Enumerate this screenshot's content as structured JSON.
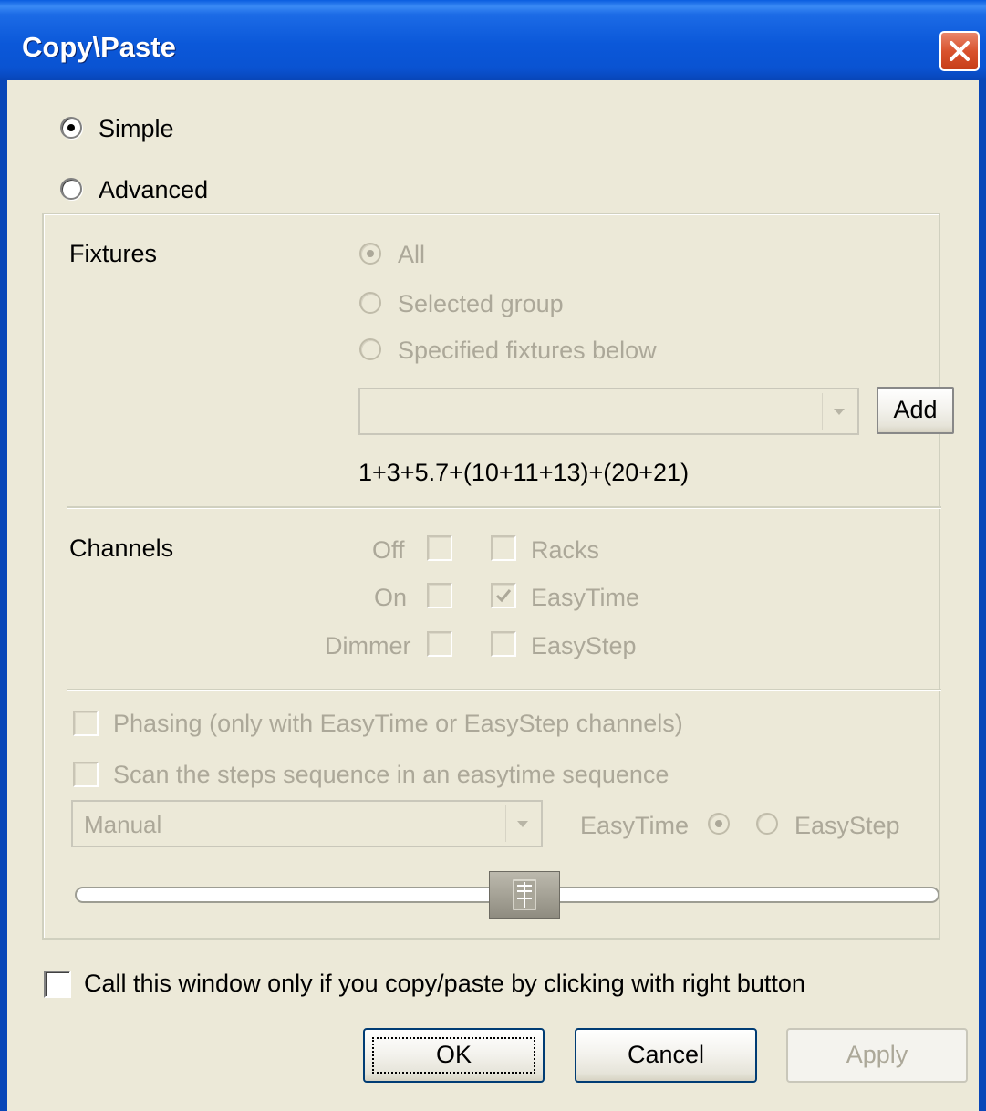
{
  "window": {
    "title": "Copy\\Paste"
  },
  "mode": {
    "simple": {
      "label": "Simple",
      "checked": true
    },
    "advanced": {
      "label": "Advanced",
      "checked": false
    }
  },
  "fixtures": {
    "heading": "Fixtures",
    "all": "All",
    "selected_group": "Selected group",
    "specified": "Specified fixtures below",
    "combo_value": "",
    "add_label": "Add",
    "expression": "1+3+5.7+(10+11+13)+(20+21)"
  },
  "channels": {
    "heading": "Channels",
    "off": "Off",
    "on": "On",
    "dimmer": "Dimmer",
    "racks": "Racks",
    "easytime": "EasyTime",
    "easystep": "EasyStep"
  },
  "options": {
    "phasing": "Phasing (only with EasyTime or EasyStep channels)",
    "scan": "Scan the steps sequence in an easytime sequence",
    "mode_combo": "Manual",
    "easytime_label": "EasyTime",
    "easystep_label": "EasyStep"
  },
  "slider": {
    "value": 0.52
  },
  "footer": {
    "right_click_only": "Call this window only if you copy/paste by clicking with right button",
    "ok": "OK",
    "cancel": "Cancel",
    "apply": "Apply"
  }
}
